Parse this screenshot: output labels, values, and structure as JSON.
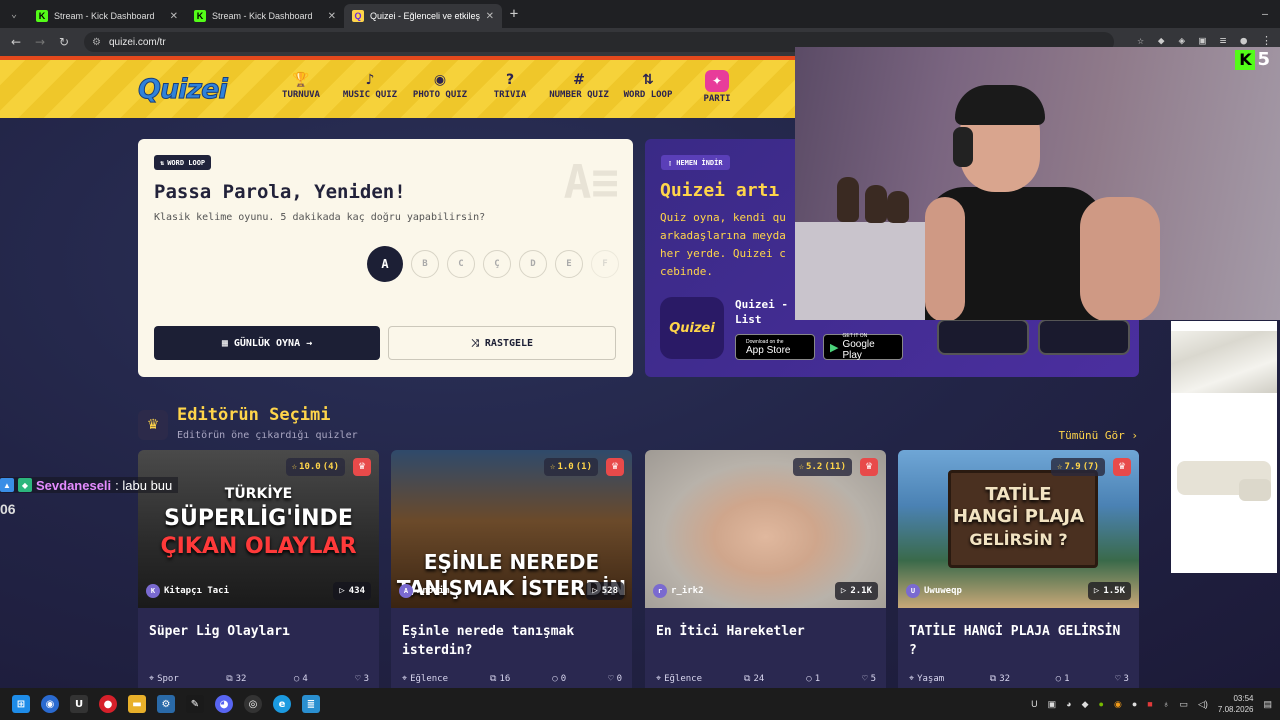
{
  "browser": {
    "tabs": [
      {
        "title": "Stream - Kick Dashboard",
        "favicon": "K"
      },
      {
        "title": "Stream - Kick Dashboard",
        "favicon": "K"
      },
      {
        "title": "Quizei - Eğlenceli ve etkileşimli",
        "favicon": "Q"
      }
    ],
    "url": "quizei.com/tr"
  },
  "site": {
    "logo": "Quizei",
    "nav": [
      {
        "label": "TURNUVA",
        "icon": "trophy-icon",
        "glyph": "🏆"
      },
      {
        "label": "MUSIC QUIZ",
        "icon": "music-note-icon",
        "glyph": "♪"
      },
      {
        "label": "PHOTO QUIZ",
        "icon": "camera-icon",
        "glyph": "◉"
      },
      {
        "label": "TRIVIA",
        "icon": "question-bubble-icon",
        "glyph": "?"
      },
      {
        "label": "NUMBER QUIZ",
        "icon": "hash-icon",
        "glyph": "#"
      },
      {
        "label": "WORD LOOP",
        "icon": "sort-az-icon",
        "glyph": "⇅"
      },
      {
        "label": "PARTI",
        "icon": "party-popper-icon",
        "glyph": "✦"
      }
    ]
  },
  "word_loop": {
    "badge": "WORD LOOP",
    "title": "Passa Parola, Yeniden!",
    "subtitle": "Klasik kelime oyunu. 5 dakikada kaç doğru yapabilirsin?",
    "letters": [
      "A",
      "B",
      "C",
      "Ç",
      "D",
      "E",
      "F"
    ],
    "daily_button": "GÜNLÜK OYNA",
    "random_button": "RASTGELE"
  },
  "app_promo": {
    "badge": "HEMEN İNDİR",
    "title": "Quizei artı",
    "desc_lines": [
      "Quiz oyna, kendi qu",
      "arkadaşlarına meyda",
      "her yerde. Quizei c",
      "cebinde."
    ],
    "app_name_line1": "Quizei -",
    "app_name_line2": "List",
    "appstore_small": "Download on the",
    "appstore_large": "App Store",
    "googleplay_small": "GET IT ON",
    "googleplay_large": "Google Play"
  },
  "editors_pick": {
    "title": "Editörün Seçimi",
    "subtitle": "Editörün öne çıkardığı quizler",
    "see_all": "Tümünü Gör"
  },
  "cards": [
    {
      "rating": "10.0",
      "votes": "(4)",
      "author": "Kitapçı Taci",
      "author_initial": "K",
      "plays": "434",
      "title": "Süper Lig Olayları",
      "category": "Spor",
      "questions": "32",
      "comments": "4",
      "likes": "3",
      "thumb_line1": "TÜRKİYE",
      "thumb_line2": "SÜPERLİG'İNDE",
      "thumb_line3": "ÇIKAN OLAYLAR",
      "thumb_color": "#3a3a3a"
    },
    {
      "rating": "1.0",
      "votes": "(1)",
      "author": "Anonim",
      "author_initial": "A",
      "plays": "528",
      "title": "Eşinle nerede tanışmak isterdin?",
      "category": "Eğlence",
      "questions": "16",
      "comments": "0",
      "likes": "0",
      "thumb_line1": "",
      "thumb_line2": "EŞİNLE NEREDE",
      "thumb_line3": "TANIŞMAK İSTERDİN",
      "thumb_color": "#5a3b22"
    },
    {
      "rating": "5.2",
      "votes": "(11)",
      "author": "r_irk2",
      "author_initial": "r",
      "plays": "2.1K",
      "title": "En İtici Hareketler",
      "category": "Eğlence",
      "questions": "24",
      "comments": "1",
      "likes": "5",
      "thumb_line1": "",
      "thumb_line2": "",
      "thumb_line3": "",
      "thumb_color": "#b7b0a8"
    },
    {
      "rating": "7.9",
      "votes": "(7)",
      "author": "Uwuweqp",
      "author_initial": "U",
      "plays": "1.5K",
      "title": "TATİLE HANGİ PLAJA GELİRSİN ?",
      "category": "Yaşam",
      "questions": "32",
      "comments": "1",
      "likes": "3",
      "thumb_line1": "TATİLE",
      "thumb_line2": "HANGİ PLAJA",
      "thumb_line3": "GELİRSİN ?",
      "thumb_color": "#4a7aa8"
    }
  ],
  "stream_overlay": {
    "camera_logo": "5",
    "chat_user": "Sevdaneseli",
    "chat_message": ": labu buu",
    "chat_partial": "06"
  },
  "taskbar": {
    "time": "03:54",
    "date": "7.08.2026"
  }
}
